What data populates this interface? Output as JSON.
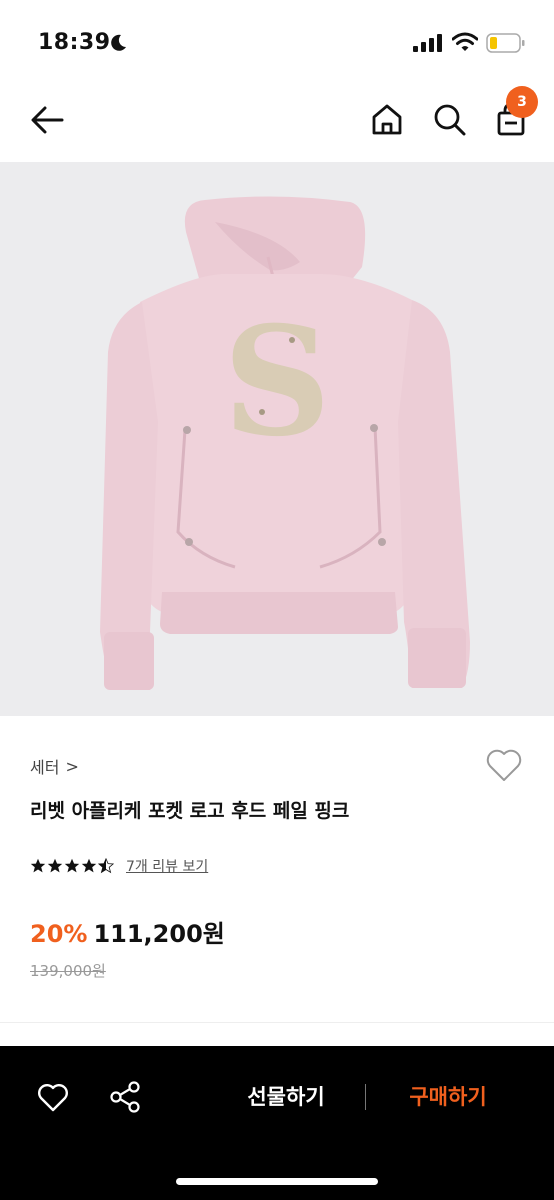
{
  "status_bar": {
    "time": "18:39",
    "icons": [
      "moon-icon",
      "signal-icon",
      "wifi-icon",
      "battery-icon"
    ]
  },
  "header": {
    "icons": [
      "back-arrow-icon",
      "home-icon",
      "search-icon",
      "shopping-bag-icon"
    ],
    "cart_count": "3"
  },
  "product": {
    "image": "pink-hoodie-photo",
    "image_letter": "S",
    "category": "세터",
    "category_chevron": ">",
    "title": "리벳 아플리케 포켓 로고 후드 페일 핑크",
    "rating": 4.5,
    "review_link": "7개 리뷰 보기",
    "discount": "20%",
    "price": "111,200원",
    "original_price": "139,000원"
  },
  "bottom_bar": {
    "gift_label": "선물하기",
    "buy_label": "구매하기"
  },
  "colors": {
    "accent": "#f0601e",
    "bottom_bar_bg": "#000000",
    "image_bg": "#ececee",
    "hoodie": "#efd2da"
  }
}
